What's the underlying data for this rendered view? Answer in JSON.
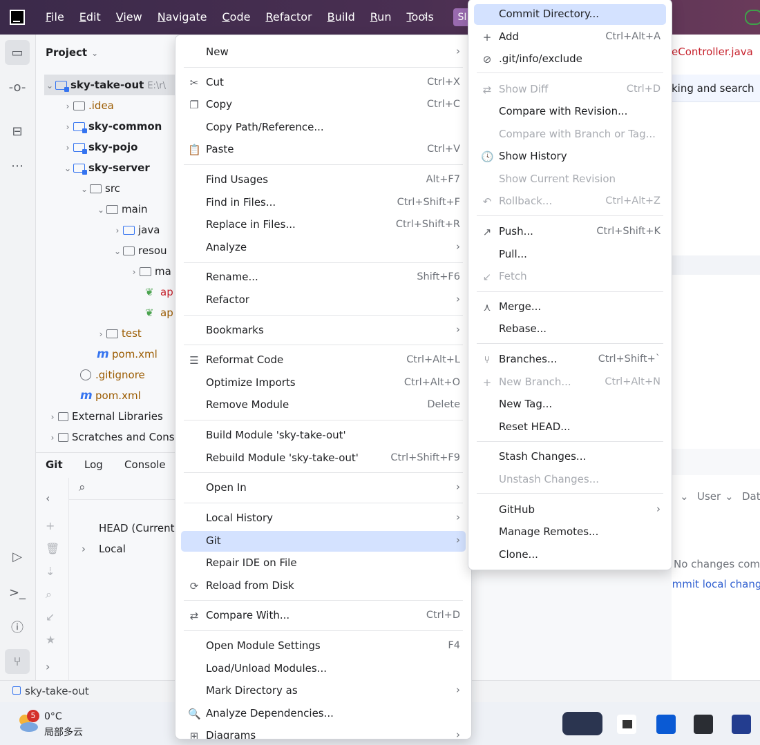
{
  "titlebar": {
    "menu": [
      "File",
      "Edit",
      "View",
      "Navigate",
      "Code",
      "Refactor",
      "Build",
      "Run",
      "Tools"
    ],
    "more": "›",
    "project_badge": "SI"
  },
  "project": {
    "header": "Project",
    "tree": [
      {
        "label": "sky-take-out",
        "path_hint": "E:\\r\\"
      },
      {
        "label": ".idea"
      },
      {
        "label": "sky-common"
      },
      {
        "label": "sky-pojo"
      },
      {
        "label": "sky-server"
      },
      {
        "label": "src"
      },
      {
        "label": "main"
      },
      {
        "label": "java"
      },
      {
        "label": "resou"
      },
      {
        "label": "ma"
      },
      {
        "label": "ap"
      },
      {
        "label": "ap"
      },
      {
        "label": "test"
      },
      {
        "label": "pom.xml"
      },
      {
        "label": ".gitignore"
      },
      {
        "label": "pom.xml"
      },
      {
        "label": "External Libraries"
      },
      {
        "label": "Scratches and Cons"
      }
    ]
  },
  "git_panel": {
    "tabs": [
      "Git",
      "Log",
      "Console"
    ],
    "branches": [
      "HEAD (Current",
      "Local"
    ]
  },
  "editor": {
    "tab": "eController.java",
    "notice": "king and search",
    "log_columns": [
      "n",
      "User",
      "Dat"
    ],
    "no_changes": "No changes comm",
    "commit_local": "Commit local change"
  },
  "statusbar": {
    "path": "sky-take-out"
  },
  "taskbar": {
    "weather_badge": "5",
    "temp": "0°C",
    "desc": "局部多云"
  },
  "main_menu": {
    "items": [
      {
        "label": "New",
        "shortcut": "",
        "sub": true
      },
      {
        "label": "Cut",
        "shortcut": "Ctrl+X",
        "icon": "✂"
      },
      {
        "label": "Copy",
        "shortcut": "Ctrl+C",
        "icon": "❐"
      },
      {
        "label": "Copy Path/Reference...",
        "shortcut": ""
      },
      {
        "label": "Paste",
        "shortcut": "Ctrl+V",
        "icon": "📋"
      },
      {
        "label": "Find Usages",
        "shortcut": "Alt+F7"
      },
      {
        "label": "Find in Files...",
        "shortcut": "Ctrl+Shift+F"
      },
      {
        "label": "Replace in Files...",
        "shortcut": "Ctrl+Shift+R"
      },
      {
        "label": "Analyze",
        "shortcut": "",
        "sub": true
      },
      {
        "label": "Rename...",
        "shortcut": "Shift+F6"
      },
      {
        "label": "Refactor",
        "shortcut": "",
        "sub": true
      },
      {
        "label": "Bookmarks",
        "shortcut": "",
        "sub": true
      },
      {
        "label": "Reformat Code",
        "shortcut": "Ctrl+Alt+L",
        "icon": "☰"
      },
      {
        "label": "Optimize Imports",
        "shortcut": "Ctrl+Alt+O"
      },
      {
        "label": "Remove Module",
        "shortcut": "Delete"
      },
      {
        "label": "Build Module 'sky-take-out'",
        "shortcut": ""
      },
      {
        "label": "Rebuild Module 'sky-take-out'",
        "shortcut": "Ctrl+Shift+F9"
      },
      {
        "label": "Open In",
        "shortcut": "",
        "sub": true
      },
      {
        "label": "Local History",
        "shortcut": "",
        "sub": true
      },
      {
        "label": "Git",
        "shortcut": "",
        "sub": true
      },
      {
        "label": "Repair IDE on File",
        "shortcut": ""
      },
      {
        "label": "Reload from Disk",
        "shortcut": "",
        "icon": "⟳"
      },
      {
        "label": "Compare With...",
        "shortcut": "Ctrl+D",
        "icon": "⇄"
      },
      {
        "label": "Open Module Settings",
        "shortcut": "F4"
      },
      {
        "label": "Load/Unload Modules...",
        "shortcut": ""
      },
      {
        "label": "Mark Directory as",
        "shortcut": "",
        "sub": true
      },
      {
        "label": "Analyze Dependencies...",
        "shortcut": "",
        "icon": "🔍"
      },
      {
        "label": "Diagrams",
        "shortcut": "",
        "sub": true,
        "icon": "⊞"
      }
    ]
  },
  "git_menu": {
    "items": [
      {
        "label": "Commit Directory...",
        "shortcut": ""
      },
      {
        "label": "Add",
        "shortcut": "Ctrl+Alt+A",
        "icon": "+"
      },
      {
        "label": ".git/info/exclude",
        "shortcut": "",
        "icon": "⊘"
      },
      {
        "label": "Show Diff",
        "shortcut": "Ctrl+D",
        "icon": "⇄"
      },
      {
        "label": "Compare with Revision...",
        "shortcut": ""
      },
      {
        "label": "Compare with Branch or Tag...",
        "shortcut": ""
      },
      {
        "label": "Show History",
        "shortcut": "",
        "icon": "🕓"
      },
      {
        "label": "Show Current Revision",
        "shortcut": ""
      },
      {
        "label": "Rollback...",
        "shortcut": "Ctrl+Alt+Z",
        "icon": "↶"
      },
      {
        "label": "Push...",
        "shortcut": "Ctrl+Shift+K",
        "icon": "↗"
      },
      {
        "label": "Pull...",
        "shortcut": ""
      },
      {
        "label": "Fetch",
        "shortcut": "",
        "icon": "↙"
      },
      {
        "label": "Merge...",
        "shortcut": "",
        "icon": "⋏"
      },
      {
        "label": "Rebase...",
        "shortcut": ""
      },
      {
        "label": "Branches...",
        "shortcut": "Ctrl+Shift+`",
        "icon": "⑂"
      },
      {
        "label": "New Branch...",
        "shortcut": "Ctrl+Alt+N",
        "icon": "+"
      },
      {
        "label": "New Tag...",
        "shortcut": ""
      },
      {
        "label": "Reset HEAD...",
        "shortcut": ""
      },
      {
        "label": "Stash Changes...",
        "shortcut": ""
      },
      {
        "label": "Unstash Changes...",
        "shortcut": ""
      },
      {
        "label": "GitHub",
        "shortcut": "",
        "sub": true
      },
      {
        "label": "Manage Remotes...",
        "shortcut": ""
      },
      {
        "label": "Clone...",
        "shortcut": ""
      }
    ]
  }
}
